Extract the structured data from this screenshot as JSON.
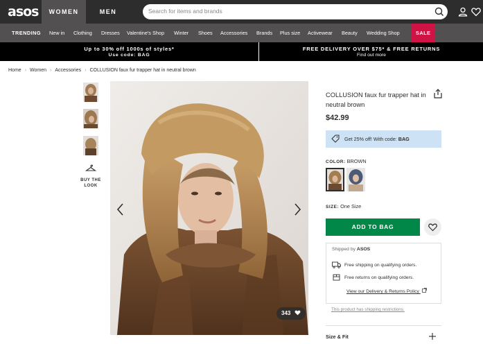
{
  "header": {
    "logo": "asos",
    "tab_women": "WOMEN",
    "tab_men": "MEN",
    "search_placeholder": "Search for items and brands"
  },
  "nav": {
    "trending": "TRENDING",
    "items": [
      "New in",
      "Clothing",
      "Dresses",
      "Valentine's Shop",
      "Winter",
      "Shoes",
      "Accessories",
      "Brands",
      "Plus size",
      "Activewear",
      "Beauty",
      "Wedding Shop"
    ],
    "sale": "SALE"
  },
  "promo": {
    "left_title": "Up to 30% off 1000s of styles*",
    "left_sub": "Use code: BAG",
    "right_title": "FREE DELIVERY OVER $75* & FREE RETURNS",
    "right_sub": "Find out more"
  },
  "breadcrumb": [
    "Home",
    "Women",
    "Accessories",
    "COLLUSION faux fur trapper hat in neutral brown"
  ],
  "gallery": {
    "buy_the_look": "BUY THE LOOK",
    "likes": "343"
  },
  "product": {
    "title": "COLLUSION faux fur trapper hat in neutral brown",
    "price": "$42.99",
    "promo_text": "Get 25% off! With code: ",
    "promo_code": "BAG",
    "color_label": "COLOR:",
    "color_value": "BROWN",
    "size_label": "SIZE:",
    "size_value": "One Size",
    "add_to_bag": "ADD TO BAG"
  },
  "shipping": {
    "shipped_by": "Shipped by ",
    "shipper": "ASOS",
    "free_shipping": "Free shipping on qualifying orders.",
    "free_returns": "Free returns on qualifying orders.",
    "policy_link": "View our Delivery & Returns Policy",
    "restrictions": "This product has shipping restrictions."
  },
  "accordion": {
    "size_fit": "Size & Fit"
  },
  "colors": {
    "header_bg": "#2d2d2d",
    "nav_bg": "#525050",
    "sale_bg": "#d01345",
    "add_to_bag_bg": "#018849",
    "promo_box_bg": "#cde2f5"
  }
}
